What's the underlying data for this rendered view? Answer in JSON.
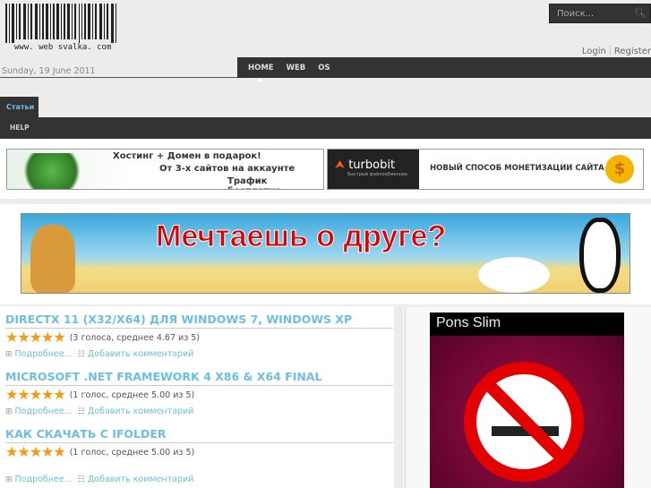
{
  "header": {
    "logo_text": "www. web svalka. com",
    "search_placeholder": "Поиск...",
    "login": "Login",
    "register": "Register",
    "date": "Sunday, 19 June 2011"
  },
  "nav": {
    "items": [
      "HOME",
      "WEB",
      "OS"
    ]
  },
  "tabs": {
    "active": "Статьи",
    "sub": "HELP"
  },
  "ads": {
    "hosting": [
      "Хостинг + Домен в подарок!",
      "От 3-х сайтов на аккаунте",
      "Трафик бесплатно"
    ],
    "turbobit_logo": "turbobit",
    "turbobit_sub": "быстрый файлообменник",
    "turbobit_text": "НОВЫЙ СПОСОБ МОНЕТИЗАЦИИ САЙТА",
    "coin": "$",
    "banner_text": "Мечтаешь о друге?",
    "side_title": "Pons Slim"
  },
  "articles": [
    {
      "title": "DIRECTX 11 (X32/X64) ДЛЯ WINDOWS 7, WINDOWS XP",
      "stars": "★★★★★",
      "rating": "(3 голоса, среднее 4.67 из 5)",
      "rating_value": 4.67,
      "more": "Подробнее...",
      "comment": "Добавить комментарий"
    },
    {
      "title": "MICROSOFT .NET FRAMEWORK 4 X86 & X64 FINAL",
      "stars": "★★★★★",
      "rating": "(1 голос, среднее 5.00 из 5)",
      "rating_value": 5.0,
      "more": "Подробнее...",
      "comment": "Добавить комментарий"
    },
    {
      "title": "КАК СКАЧАТЬ С IFOLDER",
      "stars": "★★★★★",
      "rating": "(1 голос, среднее 5.00 из 5)",
      "rating_value": 5.0,
      "more": "Подробнее...",
      "comment": "Добавить комментарий"
    }
  ]
}
